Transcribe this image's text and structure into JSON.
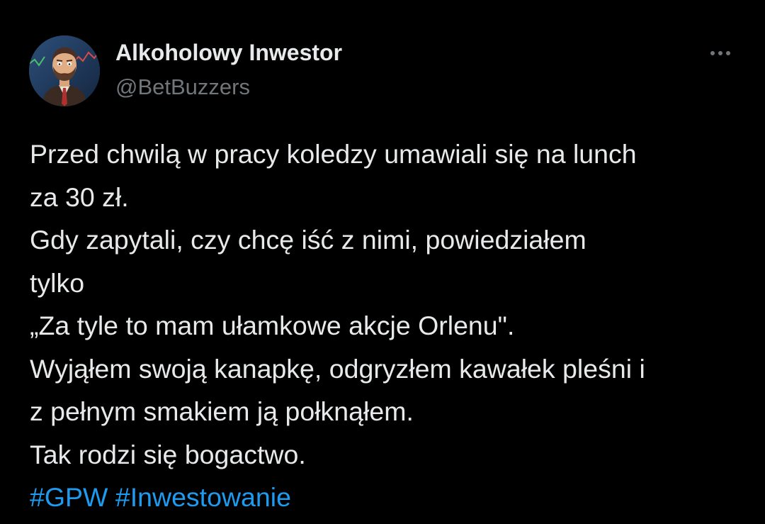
{
  "tweet": {
    "author": {
      "display_name": "Alkoholowy Inwestor",
      "handle": "@BetBuzzers",
      "avatar_icon": "cartoon-man-avatar-icon"
    },
    "more_icon": "more-horizontal-icon",
    "text_lines": [
      "Przed chwilą w pracy koledzy umawiali się na lunch",
      "za 30 zł.",
      "Gdy zapytali, czy chcę iść z nimi, powiedziałem",
      "tylko",
      "„Za tyle to mam ułamkowe akcje Orlenu\".",
      "Wyjąłem swoją kanapkę, odgryzłem kawałek pleśni i",
      "z pełnym smakiem ją połknąłem.",
      "Tak rodzi się bogactwo."
    ],
    "hashtags": [
      "#GPW",
      "#Inwestowanie"
    ]
  },
  "colors": {
    "background": "#000000",
    "text_primary": "#e7e9ea",
    "text_secondary": "#71767b",
    "link": "#1d9bf0"
  }
}
